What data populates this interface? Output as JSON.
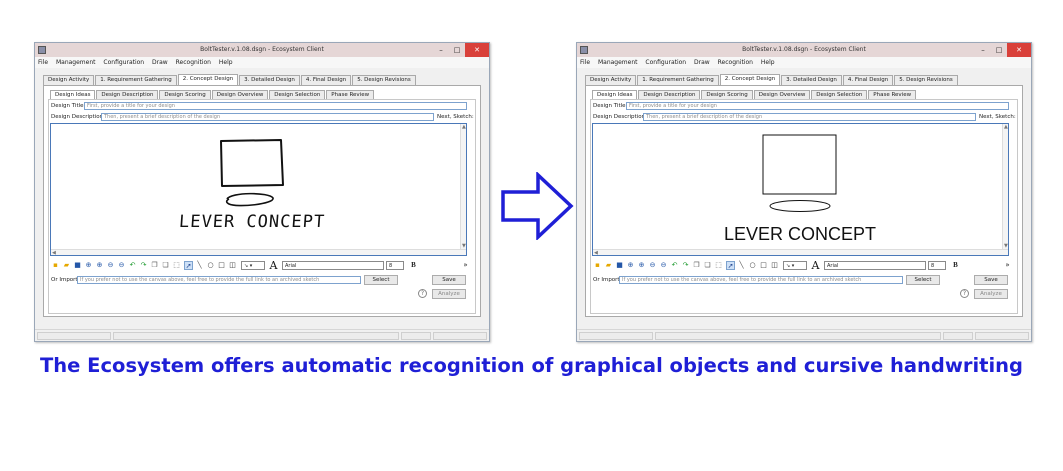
{
  "window": {
    "title": "BoltTester.v.1.08.dsgn - Ecosystem Client",
    "controls": {
      "minimize": "–",
      "maximize": "□",
      "close": "✕"
    }
  },
  "menu": [
    "File",
    "Management",
    "Configuration",
    "Draw",
    "Recognition",
    "Help"
  ],
  "top_tabs": [
    "Design Activity",
    "1. Requirement Gathering",
    "2. Concept Design",
    "3. Detailed Design",
    "4. Final Design",
    "5. Design Revisions"
  ],
  "top_tabs_active": "2. Concept Design",
  "sub_tabs": [
    "Design Ideas",
    "Design Description",
    "Design Scoring",
    "Design Overview",
    "Design Selection",
    "Phase Review"
  ],
  "sub_tabs_active": "Design Ideas",
  "form": {
    "title_label": "Design Title:",
    "title_placeholder": "First, provide a title for your design",
    "description_label": "Design Description:",
    "description_placeholder": "Then, present a brief description of the design",
    "next_label": "Next, Sketch:",
    "import_label": "Or Import:",
    "import_placeholder": "If you prefer not to use the canvas above, feel free to provide the full link to an archived sketch",
    "select_button": "Select",
    "save_button": "Save",
    "analyze_button": "Analyze",
    "help_icon": "?"
  },
  "toolbar": {
    "font_name": "Arial",
    "font_size": "8",
    "bold": "B",
    "overflow": "»",
    "text_tool": "A"
  },
  "sketch": {
    "handwritten_text": "LEVER CONCEPT",
    "recognized_text": "LEVER CONCEPT"
  },
  "caption": "The Ecosystem offers automatic recognition of graphical objects and cursive handwriting",
  "colors": {
    "caption": "#1f1fd6",
    "arrow": "#1f1fd6",
    "close": "#d9403a",
    "titlebar": "#e5d6d6"
  }
}
